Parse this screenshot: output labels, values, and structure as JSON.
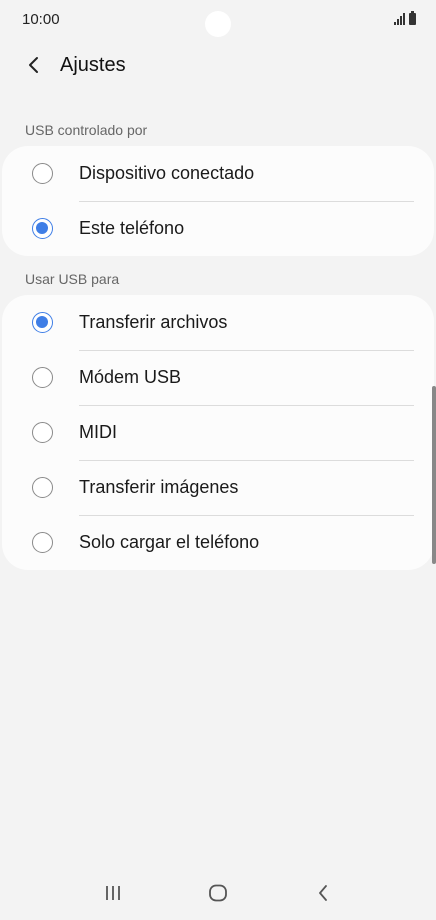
{
  "status_bar": {
    "time": "10:00"
  },
  "header": {
    "back_icon": "chevron-left-icon",
    "title": "Ajustes"
  },
  "usb_controlled_by": {
    "label": "USB controlado por",
    "options": [
      {
        "label": "Dispositivo conectado",
        "selected": false
      },
      {
        "label": "Este teléfono",
        "selected": true
      }
    ]
  },
  "use_usb_for": {
    "label": "Usar USB para",
    "options": [
      {
        "label": "Transferir archivos",
        "selected": true
      },
      {
        "label": "Módem USB",
        "selected": false
      },
      {
        "label": "MIDI",
        "selected": false
      },
      {
        "label": "Transferir imágenes",
        "selected": false
      },
      {
        "label": "Solo cargar el teléfono",
        "selected": false
      }
    ]
  },
  "nav_bar": {
    "recents_icon": "recents-icon",
    "home_icon": "home-icon",
    "back_icon": "back-icon"
  },
  "colors": {
    "accent": "#3f7ee6",
    "background": "#f3f3f3",
    "card": "#fcfcfc"
  }
}
